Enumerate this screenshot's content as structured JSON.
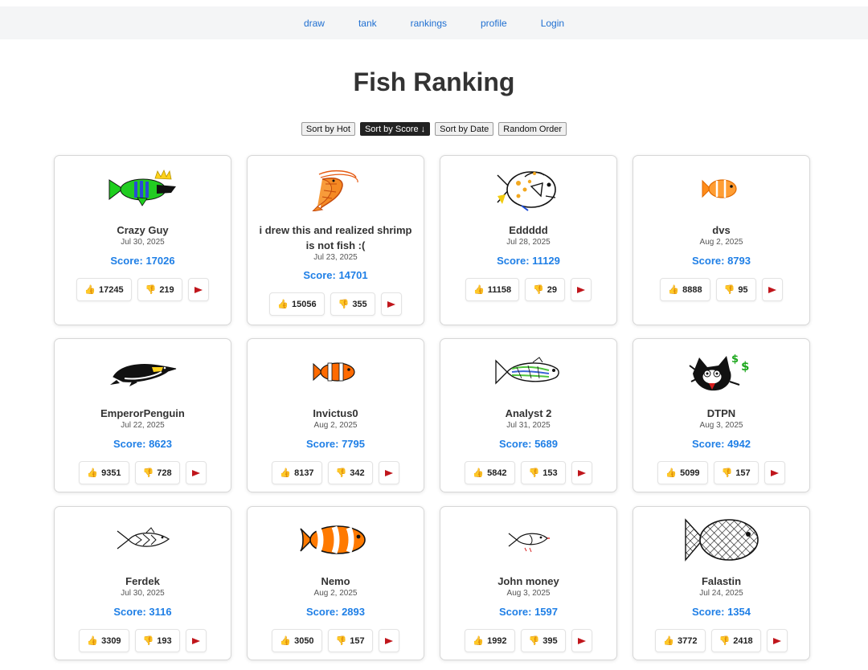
{
  "nav": {
    "items": [
      "draw",
      "tank",
      "rankings",
      "profile",
      "Login"
    ]
  },
  "page": {
    "title": "Fish Ranking"
  },
  "sort": {
    "options": [
      "Sort by Hot",
      "Sort by Score ↓",
      "Sort by Date",
      "Random Order"
    ],
    "active_index": 1
  },
  "cards": [
    {
      "name": "Crazy Guy",
      "date": "Jul 30, 2025",
      "score": "Score: 17026",
      "up": "17245",
      "down": "219",
      "art": "fish-green-crown"
    },
    {
      "name": "i drew this and realized shrimp is not fish :(",
      "date": "Jul 23, 2025",
      "score": "Score: 14701",
      "up": "15056",
      "down": "355",
      "art": "shrimp"
    },
    {
      "name": "Eddddd",
      "date": "Jul 28, 2025",
      "score": "Score: 11129",
      "up": "11158",
      "down": "29",
      "art": "fish-spotted"
    },
    {
      "name": "dvs",
      "date": "Aug 2, 2025",
      "score": "Score: 8793",
      "up": "8888",
      "down": "95",
      "art": "fish-orange-small"
    },
    {
      "name": "EmperorPenguin",
      "date": "Jul 22, 2025",
      "score": "Score: 8623",
      "up": "9351",
      "down": "728",
      "art": "penguin"
    },
    {
      "name": "Invictus0",
      "date": "Aug 2, 2025",
      "score": "Score: 7795",
      "up": "8137",
      "down": "342",
      "art": "clownfish-small"
    },
    {
      "name": "Analyst 2",
      "date": "Jul 31, 2025",
      "score": "Score: 5689",
      "up": "5842",
      "down": "153",
      "art": "fish-striped"
    },
    {
      "name": "DTPN",
      "date": "Aug 3, 2025",
      "score": "Score: 4942",
      "up": "5099",
      "down": "157",
      "art": "cat-dollar"
    },
    {
      "name": "Ferdek",
      "date": "Jul 30, 2025",
      "score": "Score: 3116",
      "up": "3309",
      "down": "193",
      "art": "fish-outline"
    },
    {
      "name": "Nemo",
      "date": "Aug 2, 2025",
      "score": "Score: 2893",
      "up": "3050",
      "down": "157",
      "art": "clownfish-large"
    },
    {
      "name": "John money",
      "date": "Aug 3, 2025",
      "score": "Score: 1597",
      "up": "1992",
      "down": "395",
      "art": "fish-tiny"
    },
    {
      "name": "Falastin",
      "date": "Jul 24, 2025",
      "score": "Score: 1354",
      "up": "3772",
      "down": "2418",
      "art": "fish-mesh"
    }
  ],
  "icons": {
    "upvote": "thumbs-up-icon",
    "downvote": "thumbs-down-icon",
    "report": "flag-icon"
  },
  "colors": {
    "link": "#1f6fd1",
    "score": "#1f7fe6",
    "flag": "#c0161c"
  }
}
